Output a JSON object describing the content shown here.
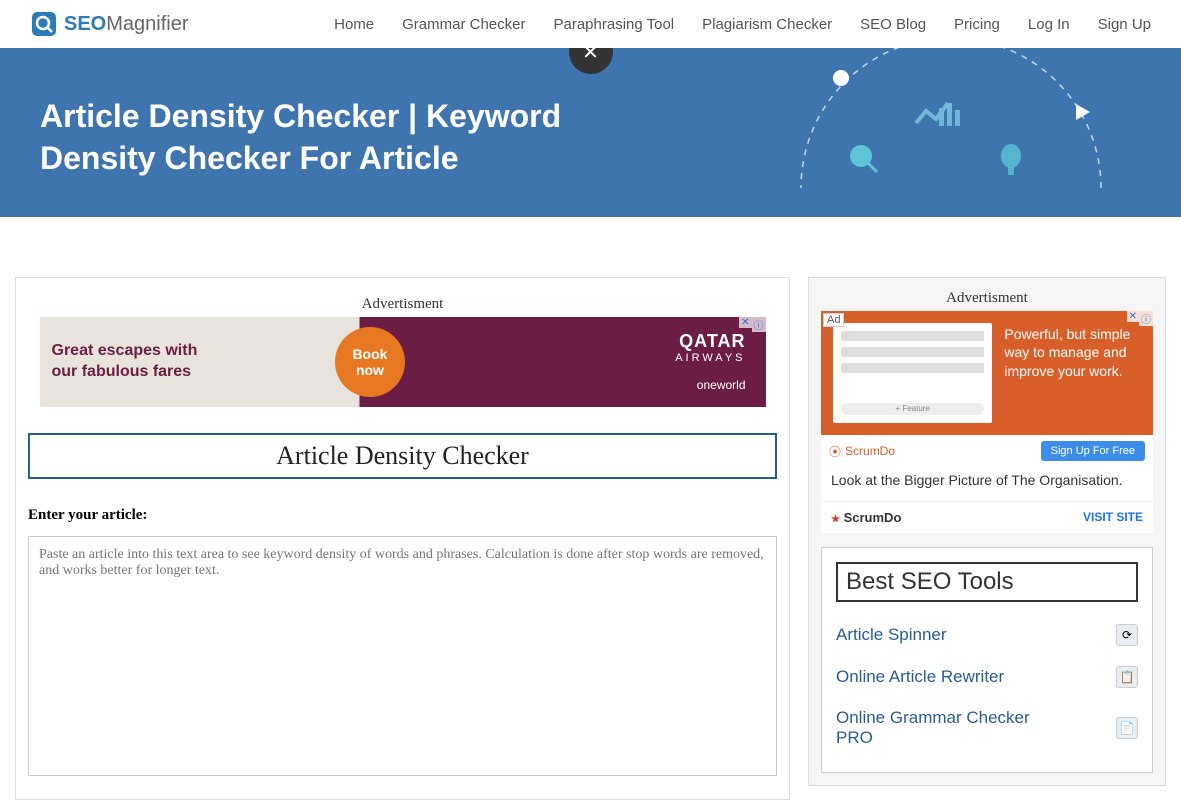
{
  "logo": {
    "seo": "SEO",
    "mag": "Magnifier"
  },
  "nav": {
    "home": "Home",
    "grammar": "Grammar Checker",
    "paraphrase": "Paraphrasing Tool",
    "plagiarism": "Plagiarism Checker",
    "blog": "SEO Blog",
    "pricing": "Pricing",
    "login": "Log In",
    "signup": "Sign Up"
  },
  "hero": {
    "title": "Article Density Checker | Keyword Density Checker For Article"
  },
  "main": {
    "ad_label": "Advertisment",
    "ad_top": {
      "text": "Great escapes with our fabulous fares",
      "book": "Book",
      "now": "now",
      "brand": "QATAR",
      "sub": "AIRWAYS",
      "ow": "oneworld"
    },
    "tool_title": "Article Density Checker",
    "input_label": "Enter your article:",
    "placeholder": "Paste an article into this text area to see keyword density of words and phrases. Calculation is done after stop words are removed, and works better for longer text."
  },
  "side": {
    "ad_label": "Advertisment",
    "ad": {
      "badge": "Ad",
      "text": "Powerful, but simple way to manage and improve your work.",
      "feature": "+ Feature",
      "brand": "ScrumDo",
      "btn": "Sign Up For Free",
      "desc": "Look at the Bigger Picture of The Organisation.",
      "brand2": "ScrumDo",
      "visit": "VISIT SITE"
    },
    "tools_title": "Best SEO Tools",
    "tools": {
      "t1": "Article Spinner",
      "t2": "Online Article Rewriter",
      "t3": "Online Grammar Checker PRO"
    }
  }
}
